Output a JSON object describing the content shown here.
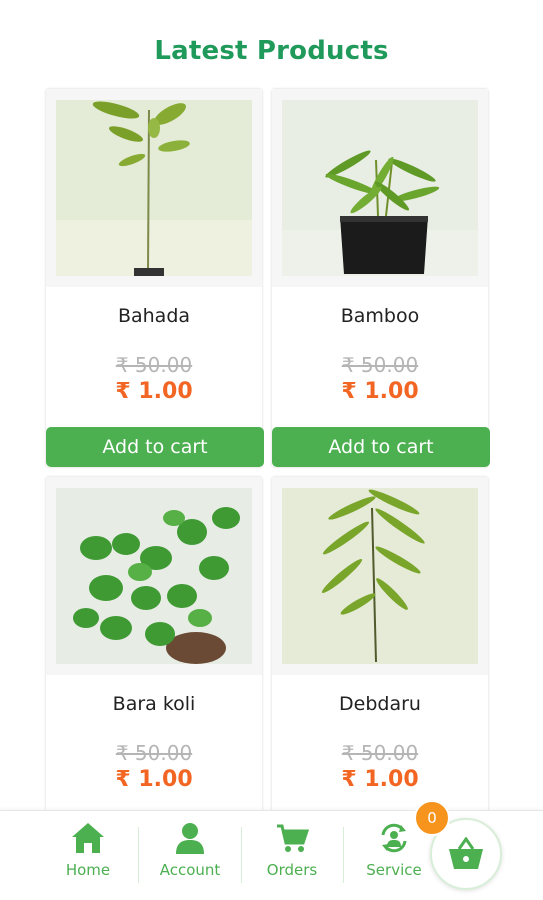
{
  "section": {
    "title": "Latest Products"
  },
  "products": [
    {
      "name": "Bahada",
      "old_price": "₹ 50.00",
      "price": "₹ 1.00",
      "button": "Add to cart",
      "image": "sapling-plant"
    },
    {
      "name": "Bamboo",
      "old_price": "₹ 50.00",
      "price": "₹ 1.00",
      "button": "Add to cart",
      "image": "bamboo-plant-in-bag"
    },
    {
      "name": "Bara koli",
      "old_price": "₹ 50.00",
      "price": "₹ 1.00",
      "button": "Add to cart",
      "image": "leafy-potted-plant"
    },
    {
      "name": "Debdaru",
      "old_price": "₹ 50.00",
      "price": "₹ 1.00",
      "button": "Add to cart",
      "image": "tall-sapling"
    }
  ],
  "nav": {
    "home": "Home",
    "account": "Account",
    "orders": "Orders",
    "service": "Service",
    "cart_count": "0"
  },
  "colors": {
    "title": "#1f9a5b",
    "accent": "#4caf50",
    "price": "#f26522",
    "badge": "#f7941d"
  }
}
